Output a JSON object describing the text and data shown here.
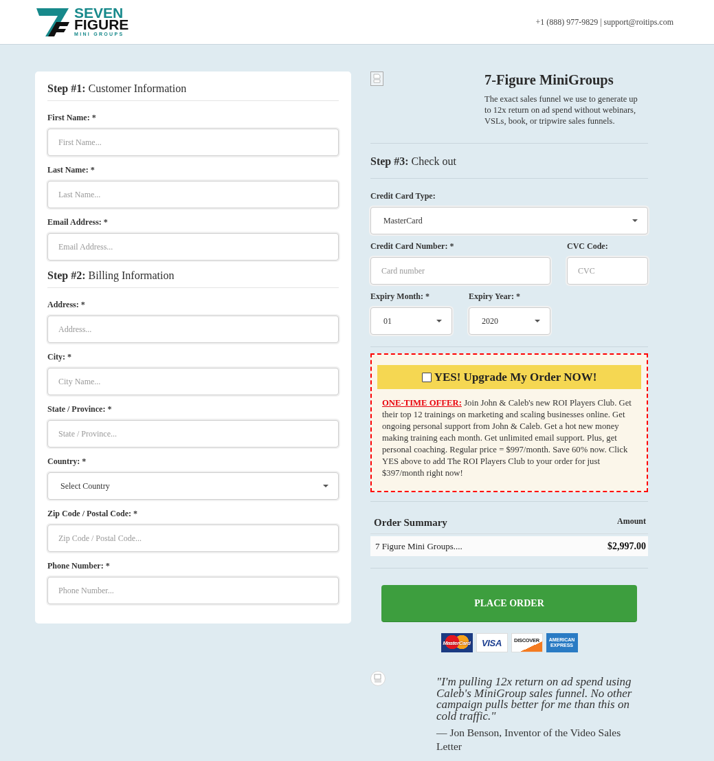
{
  "header": {
    "logo": {
      "word_1": "SEVEN",
      "word_2": "FIGURE",
      "tagline": "MINI GROUPS"
    },
    "contact": "+1 (888) 977-9829 | support@roitips.com"
  },
  "customer_information": {
    "step": "Step #1:",
    "title": "Customer Information",
    "fields": [
      {
        "kind": "input",
        "label": "First Name: *",
        "placeholder": "First Name..."
      },
      {
        "kind": "input",
        "label": "Last Name: *",
        "placeholder": "Last Name..."
      },
      {
        "kind": "input",
        "label": "Email Address: *",
        "placeholder": "Email Address..."
      }
    ]
  },
  "billing_information": {
    "step": "Step #2:",
    "title": "Billing Information",
    "fields": [
      {
        "kind": "input",
        "label": "Address: *",
        "placeholder": "Address..."
      },
      {
        "kind": "input",
        "label": "City: *",
        "placeholder": "City Name..."
      },
      {
        "kind": "input",
        "label": "State / Province: *",
        "placeholder": "State / Province..."
      },
      {
        "kind": "select",
        "label": "Country: *",
        "value": "Select Country"
      },
      {
        "kind": "input",
        "label": "Zip Code / Postal Code: *",
        "placeholder": "Zip Code / Postal Code..."
      },
      {
        "kind": "input",
        "label": "Phone Number: *",
        "placeholder": "Phone Number..."
      }
    ]
  },
  "product": {
    "title": "7-Figure MiniGroups",
    "description": "The exact sales funnel we use to generate up to 12x return on ad spend without webinars, VSLs, book, or tripwire sales funnels."
  },
  "checkout": {
    "step": "Step #3:",
    "title": "Check out",
    "fields": [
      {
        "kind": "select",
        "label": "Credit Card Type:",
        "value": "MasterCard"
      },
      {
        "kind": "input",
        "label": "Credit Card Number: *",
        "placeholder": "Card number"
      },
      {
        "kind": "input",
        "label": "CVC Code:",
        "placeholder": "CVC"
      },
      {
        "kind": "select",
        "label": "Expiry Month: *",
        "value": "01"
      },
      {
        "kind": "select",
        "label": "Expiry Year: *",
        "value": "2020"
      }
    ]
  },
  "upgrade_offer": {
    "checked": false,
    "label": "YES! Upgrade My Order NOW!",
    "offer_tag": "ONE-TIME OFFER:",
    "offer_text": "Join John & Caleb's new ROI Players Club. Get their top 12 trainings on marketing and scaling businesses online. Get ongoing personal support from John & Caleb. Get a hot new money making training each month. Get unlimited email support. Plus, get personal coaching. Regular price = $997/month. Save 60% now. Click YES above to add The ROI Players Club to your order for just $397/month right now!"
  },
  "order_summary": {
    "title": "Order Summary",
    "amount_heading": "Amount",
    "items": [
      {
        "name": "7 Figure Mini Groups....",
        "amount": "$2,997.00"
      }
    ]
  },
  "place_order_button": {
    "label": "PLACE ORDER"
  },
  "payment_logos": [
    {
      "kind": "mastercard",
      "label": "MasterCard"
    },
    {
      "kind": "visa",
      "label": "VISA"
    },
    {
      "kind": "discover",
      "label": "DISCOVER"
    },
    {
      "kind": "amex",
      "label": "AMERICAN EXPRESS"
    }
  ],
  "testimonial": {
    "quote": "\"I'm pulling 12x return on ad spend using Caleb's MiniGroup sales funnel. No other campaign pulls better for me than this on cold traffic.\"",
    "author": "— Jon Benson, Inventor of the Video Sales Letter"
  }
}
